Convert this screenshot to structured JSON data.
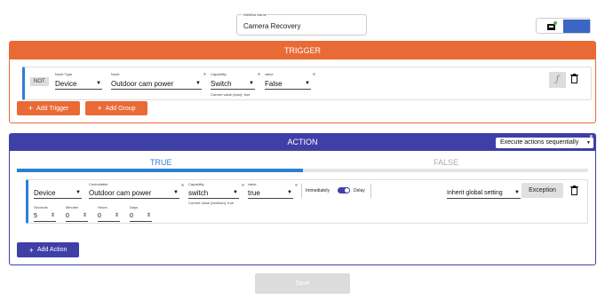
{
  "header": {
    "name_label": "WebBot Name",
    "name_value": "Camera Recovery",
    "save_icon": "save-icon",
    "accent": "#3a66c4"
  },
  "trigger": {
    "title": "TRIGGER",
    "color": "#ea6a35",
    "row": {
      "not_label": "NOT",
      "node_type_label": "Node Type",
      "node_type": "Device",
      "node_label": "Node",
      "node": "Outdoor cam power",
      "capability_label": "Capability",
      "capability": "Switch",
      "current_value": "Current value (bool): true",
      "value_label": "value",
      "value": "False",
      "func_icon": "function-icon"
    },
    "add_trigger": "Add Trigger",
    "add_group": "Add Group"
  },
  "action": {
    "title": "ACTION",
    "color": "#3f3fa8",
    "mode": "Execute actions sequentially",
    "tab_true": "TRUE",
    "tab_false": "FALSE",
    "row": {
      "controllable_label": "Controllable",
      "type": "Device",
      "controllable": "Outdoor cam power",
      "capability_label": "Capability",
      "capability": "switch",
      "current_value": "Current value (boolean): true",
      "value_label": "value",
      "value": "true",
      "immediately": "Immediately",
      "delay": "Delay",
      "inherit": "Inherit global setting",
      "exception": "Exception",
      "seconds_label": "Seconds",
      "seconds": "5",
      "minutes_label": "Minutes",
      "minutes": "0",
      "hours_label": "Hours",
      "hours": "0",
      "days_label": "Days",
      "days": "0"
    },
    "add_action": "Add Action"
  },
  "save": "Save"
}
